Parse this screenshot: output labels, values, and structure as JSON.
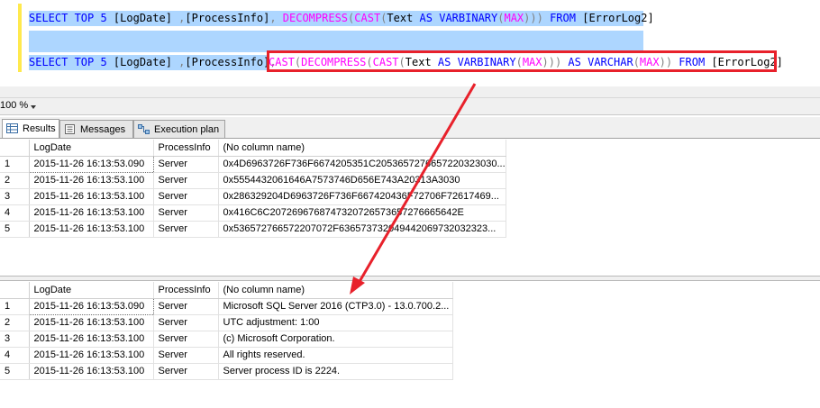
{
  "editor": {
    "line1": {
      "p1": "SELECT TOP 5 ",
      "p2": "[LogDate] ",
      "p3": ",",
      "p4": "[ProcessInfo]",
      "p5": ",",
      "p6": " DECOMPRESS",
      "p7": "(",
      "p8": "CAST",
      "p9": "(",
      "p10": "Text ",
      "p11": "AS VARBINARY",
      "p12": "(",
      "p13": "MAX",
      "p14": ")))",
      "p15": " FROM ",
      "p16": "[ErrorLog2]"
    },
    "line3": {
      "p1": "SELECT TOP 5 ",
      "p2": "[LogDate] ",
      "p3": ",",
      "p4": "[ProcessInfo]",
      "p5": ",",
      "p6": "CAST",
      "p7": "(",
      "p8": "DECOMPRESS",
      "p9": "(",
      "p10": "CAST",
      "p11": "(",
      "p12": "Text ",
      "p13": "AS VARBINARY",
      "p14": "(",
      "p15": "MAX",
      "p16": ")))",
      "p17": " AS VARCHAR",
      "p18": "(",
      "p19": "MAX",
      "p20": "))",
      "p21": " FROM ",
      "p22": "[ErrorLog2]"
    }
  },
  "zoom": {
    "value": "100 %"
  },
  "tabs": [
    {
      "label": "Results",
      "icon": "grid-icon"
    },
    {
      "label": "Messages",
      "icon": "messages-icon"
    },
    {
      "label": "Execution plan",
      "icon": "execution-plan-icon"
    }
  ],
  "grid1": {
    "headers": [
      "LogDate",
      "ProcessInfo",
      "(No column name)"
    ],
    "rows": [
      [
        "1",
        "2015-11-26 16:13:53.090",
        "Server",
        "0x4D6963726F736F6674205351C2053657276657220323030..."
      ],
      [
        "2",
        "2015-11-26 16:13:53.100",
        "Server",
        "0x5554432061646A7573746D656E743A20313A3030"
      ],
      [
        "3",
        "2015-11-26 16:13:53.100",
        "Server",
        "0x286329204D6963726F736F667420436F72706F72617469..."
      ],
      [
        "4",
        "2015-11-26 16:13:53.100",
        "Server",
        "0x416C6C2072696768747320726573657276665642E"
      ],
      [
        "5",
        "2015-11-26 16:13:53.100",
        "Server",
        "0x536572766572207072F636573732049442069732032323..."
      ]
    ]
  },
  "grid2": {
    "headers": [
      "LogDate",
      "ProcessInfo",
      "(No column name)"
    ],
    "rows": [
      [
        "1",
        "2015-11-26 16:13:53.090",
        "Server",
        "Microsoft SQL Server 2016 (CTP3.0) - 13.0.700.2..."
      ],
      [
        "2",
        "2015-11-26 16:13:53.100",
        "Server",
        "UTC adjustment: 1:00"
      ],
      [
        "3",
        "2015-11-26 16:13:53.100",
        "Server",
        "(c) Microsoft Corporation."
      ],
      [
        "4",
        "2015-11-26 16:13:53.100",
        "Server",
        "All rights reserved."
      ],
      [
        "5",
        "2015-11-26 16:13:53.100",
        "Server",
        "Server process ID is 2224."
      ]
    ]
  },
  "colors": {
    "keyword": "#0000ff",
    "function": "#ff00ff",
    "operator": "#808080",
    "selection": "#add6ff",
    "annotation": "#e8212b"
  }
}
